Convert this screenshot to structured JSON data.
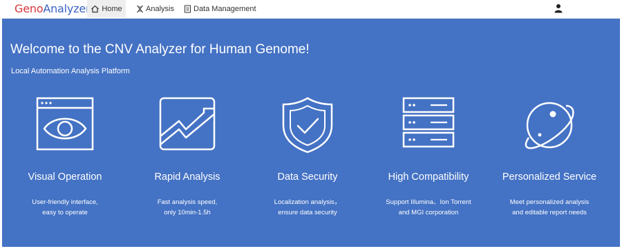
{
  "app": {
    "logo_part1": "Geno",
    "logo_part2": "Analyzer"
  },
  "nav": {
    "items": [
      {
        "label": "Home",
        "icon": "home-icon",
        "active": true
      },
      {
        "label": "Analysis",
        "icon": "dna-icon",
        "active": false
      },
      {
        "label": "Data Management",
        "icon": "document-icon",
        "active": false
      }
    ],
    "user_icon": "user-icon"
  },
  "hero": {
    "title": "Welcome to the CNV Analyzer for Human Genome!",
    "subtitle": "Local Automation Analysis Platform",
    "background": "#4472c4"
  },
  "features": [
    {
      "title": "Visual Operation",
      "desc_line1": "User-friendly interface,",
      "desc_line2": "easy to operate",
      "icon": "eye-window-icon"
    },
    {
      "title": "Rapid Analysis",
      "desc_line1": "Fast analysis speed,",
      "desc_line2": "only 10min-1.5h",
      "icon": "trend-chart-icon"
    },
    {
      "title": "Data Security",
      "desc_line1": "Localization analysis，",
      "desc_line2": "ensure data security",
      "icon": "shield-check-icon"
    },
    {
      "title": "High Compatibility",
      "desc_line1": "Support Illumina、Ion Torrent",
      "desc_line2": "and MGI corporation",
      "icon": "server-stack-icon"
    },
    {
      "title": "Personalized Service",
      "desc_line1": "Meet personalized analysis",
      "desc_line2": "and editable report needs",
      "icon": "planet-icon"
    }
  ]
}
